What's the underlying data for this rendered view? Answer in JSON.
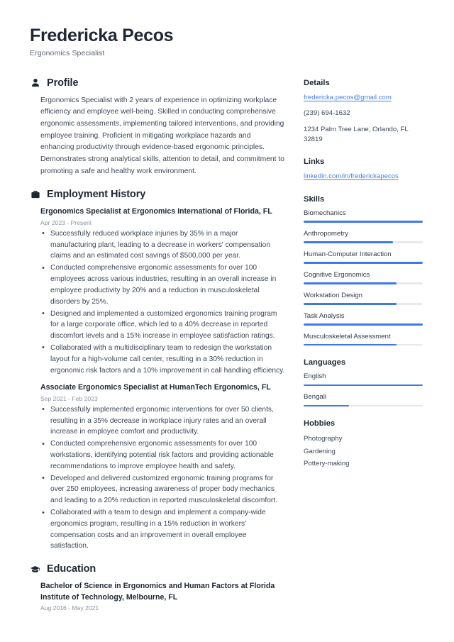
{
  "header": {
    "full_name": "Fredericka Pecos",
    "job_title": "Ergonomics Specialist"
  },
  "accent_color": "#3b7ae8",
  "link_color": "#4a7fe0",
  "sections": {
    "profile": {
      "title": "Profile",
      "icon": "person-icon",
      "text": "Ergonomics Specialist with 2 years of experience in optimizing workplace efficiency and employee well-being. Skilled in conducting comprehensive ergonomic assessments, implementing tailored interventions, and providing employee training. Proficient in mitigating workplace hazards and enhancing productivity through evidence-based ergonomic principles. Demonstrates strong analytical skills, attention to detail, and commitment to promoting a safe and healthy work environment."
    },
    "employment": {
      "title": "Employment History",
      "icon": "briefcase-icon",
      "entries": [
        {
          "title": "Ergonomics Specialist at Ergonomics International of Florida, FL",
          "date": "Apr 2023 - Present",
          "bullets": [
            "Successfully reduced workplace injuries by 35% in a major manufacturing plant, leading to a decrease in workers' compensation claims and an estimated cost savings of $500,000 per year.",
            "Conducted comprehensive ergonomic assessments for over 100 employees across various industries, resulting in an overall increase in employee productivity by 20% and a reduction in musculoskeletal disorders by 25%.",
            "Designed and implemented a customized ergonomics training program for a large corporate office, which led to a 40% decrease in reported discomfort levels and a 15% increase in employee satisfaction ratings.",
            "Collaborated with a multidisciplinary team to redesign the workstation layout for a high-volume call center, resulting in a 30% reduction in ergonomic risk factors and a 10% improvement in call handling efficiency."
          ]
        },
        {
          "title": "Associate Ergonomics Specialist at HumanTech Ergonomics, FL",
          "date": "Sep 2021 - Feb 2023",
          "bullets": [
            "Successfully implemented ergonomic interventions for over 50 clients, resulting in a 35% decrease in workplace injury rates and an overall increase in employee comfort and productivity.",
            "Conducted comprehensive ergonomic assessments for over 100 workstations, identifying potential risk factors and providing actionable recommendations to improve employee health and safety.",
            "Developed and delivered customized ergonomic training programs for over 250 employees, increasing awareness of proper body mechanics and leading to a 20% reduction in reported musculoskeletal discomfort.",
            "Collaborated with a team to design and implement a company-wide ergonomics program, resulting in a 15% reduction in workers' compensation costs and an improvement in overall employee satisfaction."
          ]
        }
      ]
    },
    "education": {
      "title": "Education",
      "icon": "graduation-cap-icon",
      "entries": [
        {
          "title": "Bachelor of Science in Ergonomics and Human Factors at Florida Institute of Technology, Melbourne, FL",
          "date": "Aug 2016 - May 2021"
        }
      ]
    }
  },
  "sidebar": {
    "details": {
      "title": "Details",
      "email": "fredericka.pecos@gmail.com",
      "phone": "(239) 694-1632",
      "address": "1234 Palm Tree Lane, Orlando, FL 32819"
    },
    "links": {
      "title": "Links",
      "items": [
        {
          "label": "linkedin.com/in/frederickapecos"
        }
      ]
    },
    "skills": {
      "title": "Skills",
      "items": [
        {
          "label": "Biomechanics",
          "level": 100
        },
        {
          "label": "Anthropometry",
          "level": 75
        },
        {
          "label": "Human-Computer Interaction",
          "level": 100
        },
        {
          "label": "Cognitive Ergonomics",
          "level": 78
        },
        {
          "label": "Workstation Design",
          "level": 78
        },
        {
          "label": "Task Analysis",
          "level": 100
        },
        {
          "label": "Musculoskeletal Assessment",
          "level": 78
        }
      ]
    },
    "languages": {
      "title": "Languages",
      "items": [
        {
          "label": "English",
          "level": 100
        },
        {
          "label": "Bengali",
          "level": 38
        }
      ]
    },
    "hobbies": {
      "title": "Hobbies",
      "items": [
        {
          "label": "Photography"
        },
        {
          "label": "Gardening"
        },
        {
          "label": "Pottery-making"
        }
      ]
    }
  }
}
